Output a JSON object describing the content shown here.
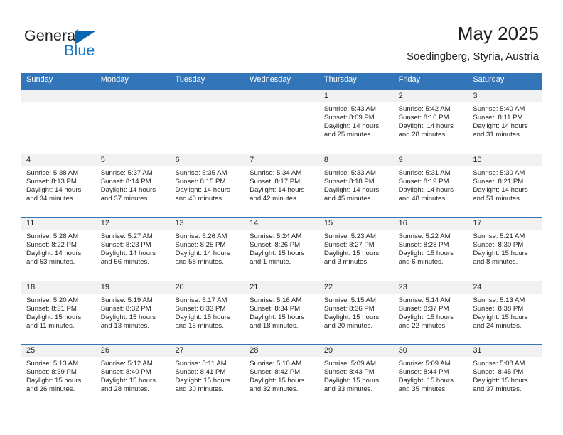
{
  "brand": {
    "logo_text_top": "General",
    "logo_text_bottom": "Blue",
    "logo_icon": "blue-triangle-icon",
    "color_dark": "#231f20",
    "color_blue": "#1577c4"
  },
  "header": {
    "title": "May 2025",
    "subtitle": "Soedingberg, Styria, Austria",
    "header_bg": "#3275b9",
    "daynum_bg": "#f1f1f1"
  },
  "weekdays": [
    "Sunday",
    "Monday",
    "Tuesday",
    "Wednesday",
    "Thursday",
    "Friday",
    "Saturday"
  ],
  "weeks": [
    [
      {
        "day": "",
        "empty": true
      },
      {
        "day": "",
        "empty": true
      },
      {
        "day": "",
        "empty": true
      },
      {
        "day": "",
        "empty": true
      },
      {
        "day": "1",
        "sunrise": "Sunrise: 5:43 AM",
        "sunset": "Sunset: 8:09 PM",
        "daylight1": "Daylight: 14 hours",
        "daylight2": "and 25 minutes."
      },
      {
        "day": "2",
        "sunrise": "Sunrise: 5:42 AM",
        "sunset": "Sunset: 8:10 PM",
        "daylight1": "Daylight: 14 hours",
        "daylight2": "and 28 minutes."
      },
      {
        "day": "3",
        "sunrise": "Sunrise: 5:40 AM",
        "sunset": "Sunset: 8:11 PM",
        "daylight1": "Daylight: 14 hours",
        "daylight2": "and 31 minutes."
      }
    ],
    [
      {
        "day": "4",
        "sunrise": "Sunrise: 5:38 AM",
        "sunset": "Sunset: 8:13 PM",
        "daylight1": "Daylight: 14 hours",
        "daylight2": "and 34 minutes."
      },
      {
        "day": "5",
        "sunrise": "Sunrise: 5:37 AM",
        "sunset": "Sunset: 8:14 PM",
        "daylight1": "Daylight: 14 hours",
        "daylight2": "and 37 minutes."
      },
      {
        "day": "6",
        "sunrise": "Sunrise: 5:35 AM",
        "sunset": "Sunset: 8:15 PM",
        "daylight1": "Daylight: 14 hours",
        "daylight2": "and 40 minutes."
      },
      {
        "day": "7",
        "sunrise": "Sunrise: 5:34 AM",
        "sunset": "Sunset: 8:17 PM",
        "daylight1": "Daylight: 14 hours",
        "daylight2": "and 42 minutes."
      },
      {
        "day": "8",
        "sunrise": "Sunrise: 5:33 AM",
        "sunset": "Sunset: 8:18 PM",
        "daylight1": "Daylight: 14 hours",
        "daylight2": "and 45 minutes."
      },
      {
        "day": "9",
        "sunrise": "Sunrise: 5:31 AM",
        "sunset": "Sunset: 8:19 PM",
        "daylight1": "Daylight: 14 hours",
        "daylight2": "and 48 minutes."
      },
      {
        "day": "10",
        "sunrise": "Sunrise: 5:30 AM",
        "sunset": "Sunset: 8:21 PM",
        "daylight1": "Daylight: 14 hours",
        "daylight2": "and 51 minutes."
      }
    ],
    [
      {
        "day": "11",
        "sunrise": "Sunrise: 5:28 AM",
        "sunset": "Sunset: 8:22 PM",
        "daylight1": "Daylight: 14 hours",
        "daylight2": "and 53 minutes."
      },
      {
        "day": "12",
        "sunrise": "Sunrise: 5:27 AM",
        "sunset": "Sunset: 8:23 PM",
        "daylight1": "Daylight: 14 hours",
        "daylight2": "and 56 minutes."
      },
      {
        "day": "13",
        "sunrise": "Sunrise: 5:26 AM",
        "sunset": "Sunset: 8:25 PM",
        "daylight1": "Daylight: 14 hours",
        "daylight2": "and 58 minutes."
      },
      {
        "day": "14",
        "sunrise": "Sunrise: 5:24 AM",
        "sunset": "Sunset: 8:26 PM",
        "daylight1": "Daylight: 15 hours",
        "daylight2": "and 1 minute."
      },
      {
        "day": "15",
        "sunrise": "Sunrise: 5:23 AM",
        "sunset": "Sunset: 8:27 PM",
        "daylight1": "Daylight: 15 hours",
        "daylight2": "and 3 minutes."
      },
      {
        "day": "16",
        "sunrise": "Sunrise: 5:22 AM",
        "sunset": "Sunset: 8:28 PM",
        "daylight1": "Daylight: 15 hours",
        "daylight2": "and 6 minutes."
      },
      {
        "day": "17",
        "sunrise": "Sunrise: 5:21 AM",
        "sunset": "Sunset: 8:30 PM",
        "daylight1": "Daylight: 15 hours",
        "daylight2": "and 8 minutes."
      }
    ],
    [
      {
        "day": "18",
        "sunrise": "Sunrise: 5:20 AM",
        "sunset": "Sunset: 8:31 PM",
        "daylight1": "Daylight: 15 hours",
        "daylight2": "and 11 minutes."
      },
      {
        "day": "19",
        "sunrise": "Sunrise: 5:19 AM",
        "sunset": "Sunset: 8:32 PM",
        "daylight1": "Daylight: 15 hours",
        "daylight2": "and 13 minutes."
      },
      {
        "day": "20",
        "sunrise": "Sunrise: 5:17 AM",
        "sunset": "Sunset: 8:33 PM",
        "daylight1": "Daylight: 15 hours",
        "daylight2": "and 15 minutes."
      },
      {
        "day": "21",
        "sunrise": "Sunrise: 5:16 AM",
        "sunset": "Sunset: 8:34 PM",
        "daylight1": "Daylight: 15 hours",
        "daylight2": "and 18 minutes."
      },
      {
        "day": "22",
        "sunrise": "Sunrise: 5:15 AM",
        "sunset": "Sunset: 8:36 PM",
        "daylight1": "Daylight: 15 hours",
        "daylight2": "and 20 minutes."
      },
      {
        "day": "23",
        "sunrise": "Sunrise: 5:14 AM",
        "sunset": "Sunset: 8:37 PM",
        "daylight1": "Daylight: 15 hours",
        "daylight2": "and 22 minutes."
      },
      {
        "day": "24",
        "sunrise": "Sunrise: 5:13 AM",
        "sunset": "Sunset: 8:38 PM",
        "daylight1": "Daylight: 15 hours",
        "daylight2": "and 24 minutes."
      }
    ],
    [
      {
        "day": "25",
        "sunrise": "Sunrise: 5:13 AM",
        "sunset": "Sunset: 8:39 PM",
        "daylight1": "Daylight: 15 hours",
        "daylight2": "and 26 minutes."
      },
      {
        "day": "26",
        "sunrise": "Sunrise: 5:12 AM",
        "sunset": "Sunset: 8:40 PM",
        "daylight1": "Daylight: 15 hours",
        "daylight2": "and 28 minutes."
      },
      {
        "day": "27",
        "sunrise": "Sunrise: 5:11 AM",
        "sunset": "Sunset: 8:41 PM",
        "daylight1": "Daylight: 15 hours",
        "daylight2": "and 30 minutes."
      },
      {
        "day": "28",
        "sunrise": "Sunrise: 5:10 AM",
        "sunset": "Sunset: 8:42 PM",
        "daylight1": "Daylight: 15 hours",
        "daylight2": "and 32 minutes."
      },
      {
        "day": "29",
        "sunrise": "Sunrise: 5:09 AM",
        "sunset": "Sunset: 8:43 PM",
        "daylight1": "Daylight: 15 hours",
        "daylight2": "and 33 minutes."
      },
      {
        "day": "30",
        "sunrise": "Sunrise: 5:09 AM",
        "sunset": "Sunset: 8:44 PM",
        "daylight1": "Daylight: 15 hours",
        "daylight2": "and 35 minutes."
      },
      {
        "day": "31",
        "sunrise": "Sunrise: 5:08 AM",
        "sunset": "Sunset: 8:45 PM",
        "daylight1": "Daylight: 15 hours",
        "daylight2": "and 37 minutes."
      }
    ]
  ]
}
